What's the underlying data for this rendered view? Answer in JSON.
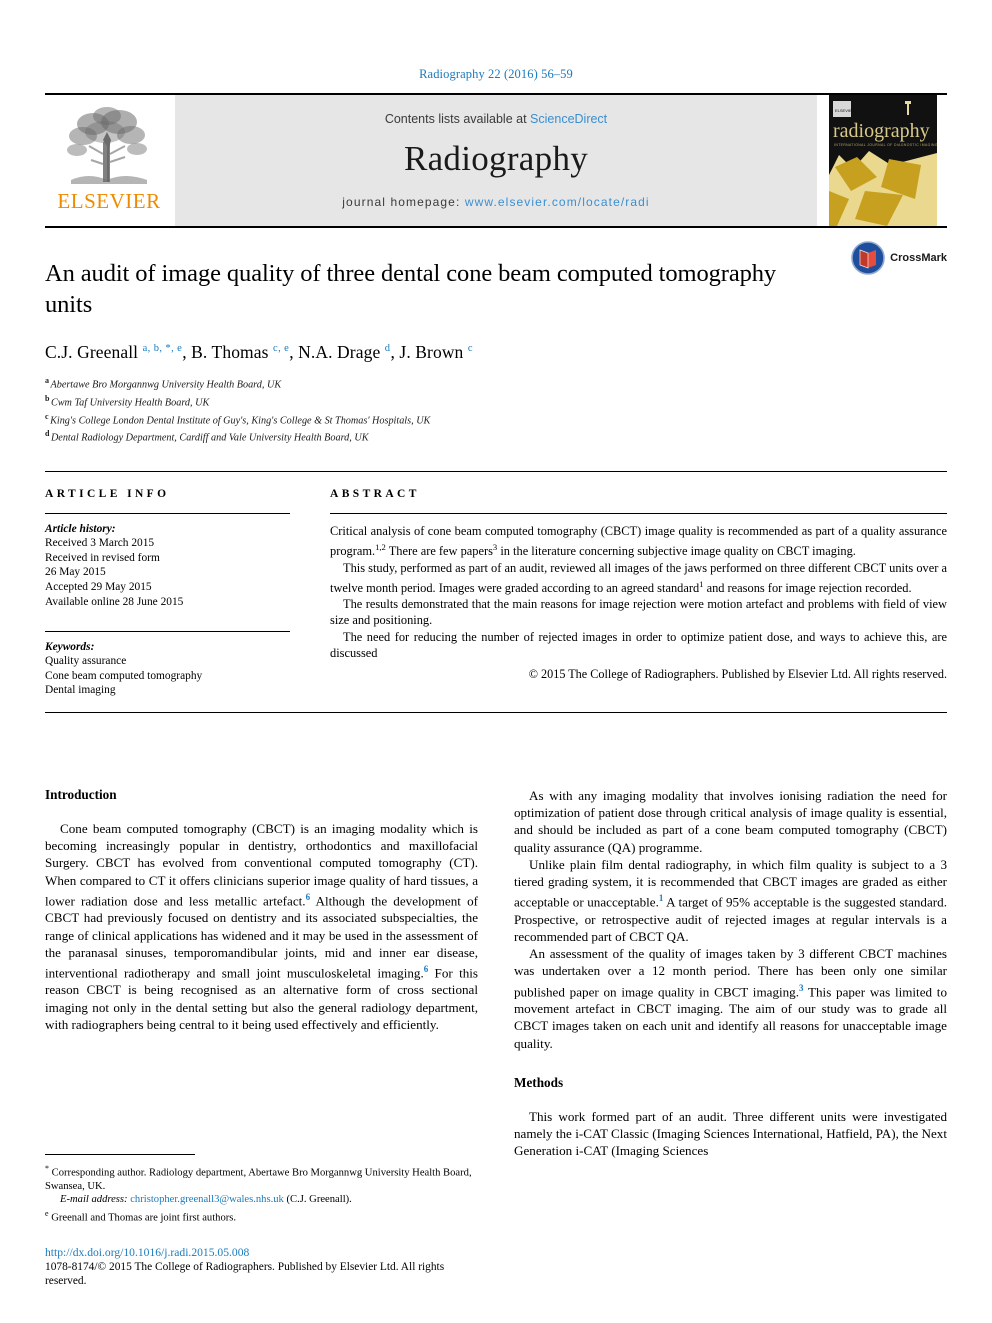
{
  "running_head": "Radiography 22 (2016) 56–59",
  "masthead": {
    "publisher_logo_label": "ELSEVIER",
    "contents_prefix": "Contents lists available at",
    "contents_link": "ScienceDirect",
    "journal_title": "Radiography",
    "homepage_prefix": "journal homepage:",
    "homepage_url": "www.elsevier.com/locate/radi",
    "cover_title": "radiography",
    "cover_subtitle": "INTERNATIONAL JOURNAL OF DIAGNOSTIC IMAGING AND RADIATION THERAPY"
  },
  "article": {
    "title": "An audit of image quality of three dental cone beam computed tomography units",
    "crossmark_label": "CrossMark",
    "authors": [
      {
        "name": "C.J. Greenall",
        "sup": "a, b, *, e"
      },
      {
        "name": "B. Thomas",
        "sup": "c, e"
      },
      {
        "name": "N.A. Drage",
        "sup": "d"
      },
      {
        "name": "J. Brown",
        "sup": "c"
      }
    ],
    "affiliations": [
      {
        "marker": "a",
        "text": "Abertawe Bro Morgannwg University Health Board, UK"
      },
      {
        "marker": "b",
        "text": "Cwm Taf University Health Board, UK"
      },
      {
        "marker": "c",
        "text": "King's College London Dental Institute of Guy's, King's College & St Thomas' Hospitals, UK"
      },
      {
        "marker": "d",
        "text": "Dental Radiology Department, Cardiff and Vale University Health Board, UK"
      }
    ]
  },
  "article_info": {
    "heading": "ARTICLE INFO",
    "history_label": "Article history:",
    "history": [
      "Received 3 March 2015",
      "Received in revised form",
      "26 May 2015",
      "Accepted 29 May 2015",
      "Available online 28 June 2015"
    ],
    "keywords_label": "Keywords:",
    "keywords": [
      "Quality assurance",
      "Cone beam computed tomography",
      "Dental imaging"
    ]
  },
  "abstract": {
    "heading": "ABSTRACT",
    "paragraphs": [
      "Critical analysis of cone beam computed tomography (CBCT) image quality is recommended as part of a quality assurance program.<sup>1,2</sup> There are few papers<sup>3</sup> in the literature concerning subjective image quality on CBCT imaging.",
      "This study, performed as part of an audit, reviewed all images of the jaws performed on three different CBCT units over a twelve month period. Images were graded according to an agreed standard<sup>1</sup> and reasons for image rejection recorded.",
      "The results demonstrated that the main reasons for image rejection were motion artefact and problems with field of view size and positioning.",
      "The need for reducing the number of rejected images in order to optimize patient dose, and ways to achieve this, are discussed"
    ],
    "copyright": "© 2015 The College of Radiographers. Published by Elsevier Ltd. All rights reserved."
  },
  "body": {
    "left_heading": "Introduction",
    "left_paragraphs": [
      "Cone beam computed tomography (CBCT) is an imaging modality which is becoming increasingly popular in dentistry, orthodontics and maxillofacial Surgery. CBCT has evolved from conventional computed tomography (CT). When compared to CT it offers clinicians superior image quality of hard tissues, a lower radiation dose and less metallic artefact.<sup>6</sup> Although the development of CBCT had previously focused on dentistry and its associated subspecialties, the range of clinical applications has widened and it may be used in the assessment of the paranasal sinuses, temporomandibular joints, mid and inner ear disease, interventional radiotherapy and small joint musculoskeletal imaging.<sup>6</sup> For this reason CBCT is being recognised as an alternative form of cross sectional imaging not only in the dental setting but also the general radiology department, with radiographers being central to it being used effectively and efficiently."
    ],
    "right_paragraphs": [
      "As with any imaging modality that involves ionising radiation the need for optimization of patient dose through critical analysis of image quality is essential, and should be included as part of a cone beam computed tomography (CBCT) quality assurance (QA) programme.",
      "Unlike plain film dental radiography, in which film quality is subject to a 3 tiered grading system, it is recommended that CBCT images are graded as either acceptable or unacceptable.<sup>1</sup> A target of 95% acceptable is the suggested standard. Prospective, or retrospective audit of rejected images at regular intervals is a recommended part of CBCT QA.",
      "An assessment of the quality of images taken by 3 different CBCT machines was undertaken over a 12 month period. There has been only one similar published paper on image quality in CBCT imaging.<sup>3</sup> This paper was limited to movement artefact in CBCT imaging. The aim of our study was to grade all CBCT images taken on each unit and identify all reasons for unacceptable image quality."
    ],
    "right_heading": "Methods",
    "right_paragraphs_2": [
      "This work formed part of an audit. Three different units were investigated namely the i-CAT Classic (Imaging Sciences International, Hatfield, PA), the Next Generation i-CAT (Imaging Sciences"
    ]
  },
  "footnotes": {
    "corresponding": "Corresponding author. Radiology department, Abertawe Bro Morgannwg University Health Board, Swansea, UK.",
    "corresponding_marker": "*",
    "email_label": "E-mail address:",
    "email": "christopher.greenall3@wales.nhs.uk",
    "email_suffix": "(C.J. Greenall).",
    "joint_marker": "e",
    "joint_authors": "Greenall and Thomas are joint first authors.",
    "doi": "http://dx.doi.org/10.1016/j.radi.2015.05.008",
    "issn_line": "1078-8174/© 2015 The College of Radiographers. Published by Elsevier Ltd. All rights reserved."
  },
  "colors": {
    "link_blue": "#1a7bbd",
    "elsevier_orange": "#ed8b00",
    "band_grey": "#e6e6e6",
    "cover_gold": "#c8a020"
  }
}
